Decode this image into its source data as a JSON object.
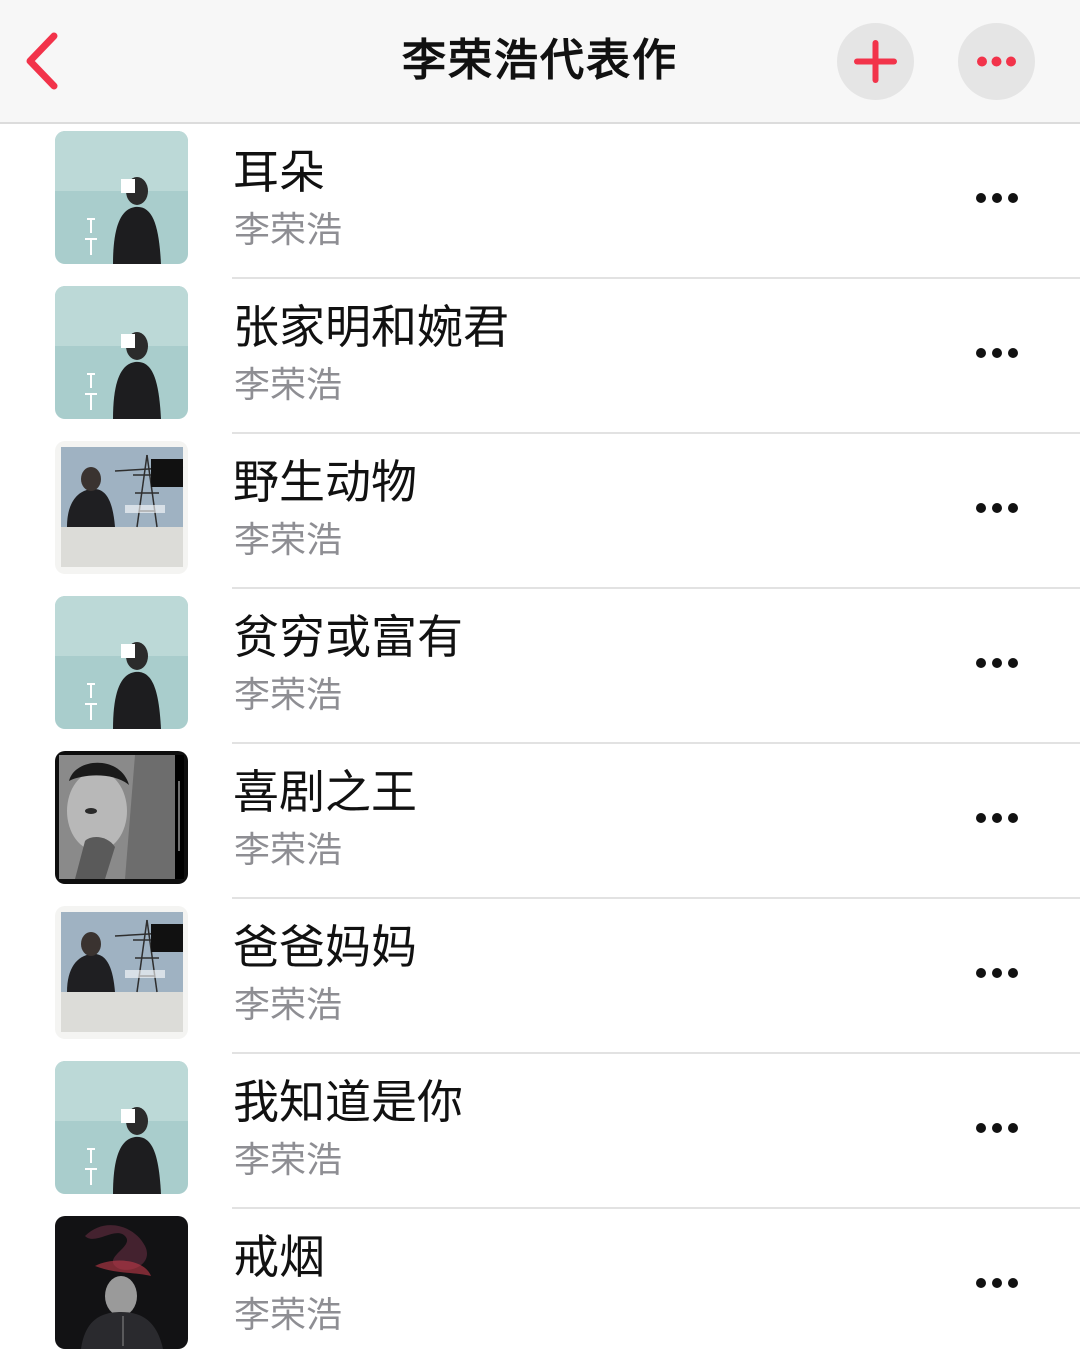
{
  "header": {
    "title": "李荣浩代表作",
    "accent_color": "#f2334a",
    "back_icon": "chevron-left-icon",
    "add_icon": "plus-icon",
    "more_icon": "ellipsis-icon"
  },
  "songs": [
    {
      "title": "耳朵",
      "artist": "李荣浩",
      "artwork": "ear-album-art"
    },
    {
      "title": "张家明和婉君",
      "artist": "李荣浩",
      "artwork": "ear-album-art"
    },
    {
      "title": "野生动物",
      "artist": "李荣浩",
      "artwork": "pylon-album-art"
    },
    {
      "title": "贫穷或富有",
      "artist": "李荣浩",
      "artwork": "ear-album-art"
    },
    {
      "title": "喜剧之王",
      "artist": "李荣浩",
      "artwork": "bw-portrait-album-art"
    },
    {
      "title": "爸爸妈妈",
      "artist": "李荣浩",
      "artwork": "pylon-album-art"
    },
    {
      "title": "我知道是你",
      "artist": "李荣浩",
      "artwork": "ear-album-art"
    },
    {
      "title": "戒烟",
      "artist": "李荣浩",
      "artwork": "dark-smoke-album-art"
    }
  ]
}
